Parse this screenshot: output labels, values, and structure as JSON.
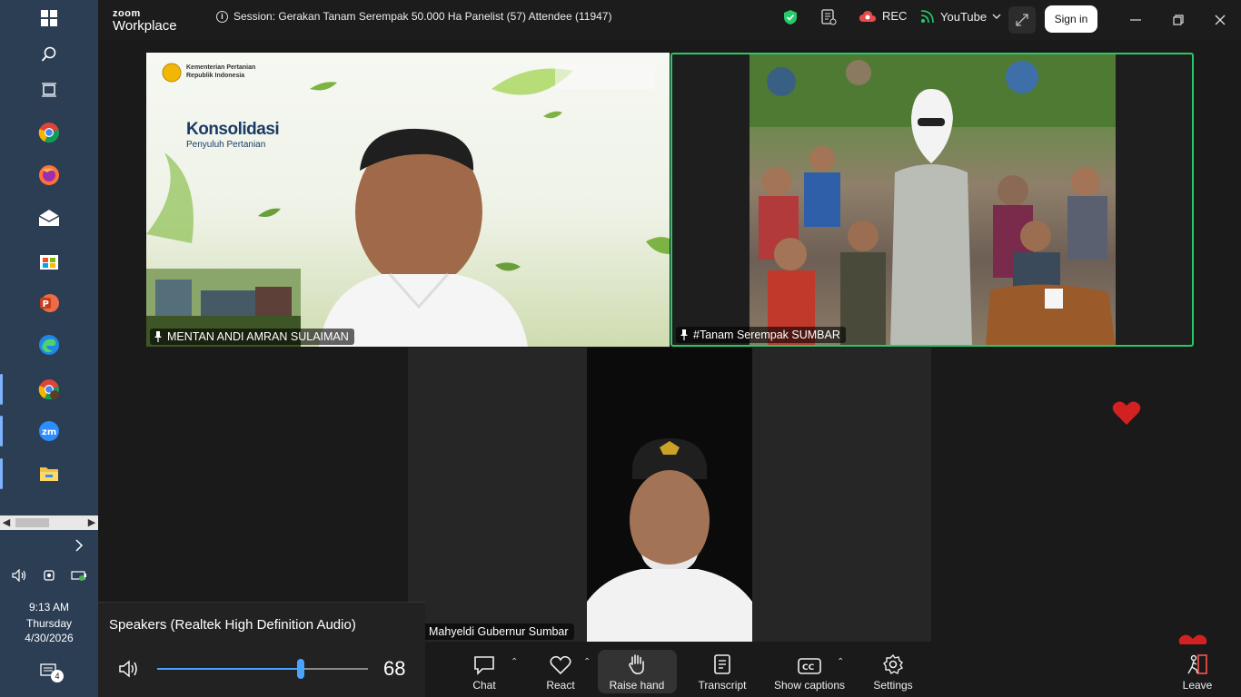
{
  "taskbar": {
    "clock": {
      "time": "9:13 AM",
      "day": "Thursday",
      "date": "4/30/2026"
    },
    "notification_count": "4"
  },
  "titlebar": {
    "logo_top": "zoom",
    "logo_bottom": "Workplace",
    "session_text": "Session: Gerakan Tanam Serempak 50.000 Ha Panelist (57) Attendee (11947)",
    "rec_label": "REC",
    "youtube_label": "YouTube",
    "signin_label": "Sign in"
  },
  "tiles": [
    {
      "label": "MENTAN ANDI AMRAN SULAIMAN",
      "slide_title": "Konsolidasi",
      "slide_subtitle": "Penyuluh Pertanian",
      "org_line1": "Kementerian Pertanian",
      "org_line2": "Republik Indonesia"
    },
    {
      "label": "#Tanam Serempak SUMBAR"
    },
    {
      "label": "Mahyeldi Gubernur Sumbar"
    }
  ],
  "toolbar": {
    "chat": "Chat",
    "react": "React",
    "raise_hand": "Raise hand",
    "transcript": "Transcript",
    "show_captions": "Show captions",
    "settings": "Settings",
    "leave": "Leave"
  },
  "volume": {
    "device": "Speakers (Realtek High Definition Audio)",
    "level": "68",
    "level_fraction": 0.68
  },
  "colors": {
    "accent_green": "#27c968",
    "volume_blue": "#4aa3ff",
    "heart_red": "#d32020"
  }
}
